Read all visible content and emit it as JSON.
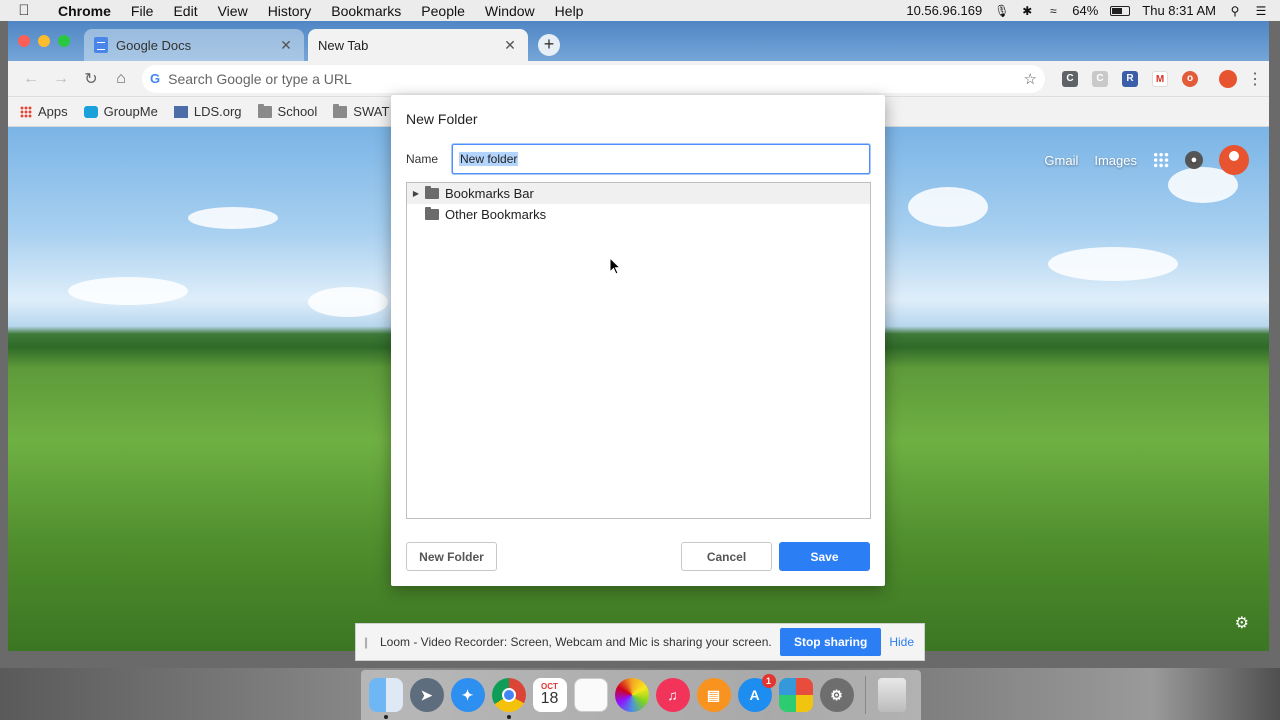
{
  "menubar": {
    "app_name": "Chrome",
    "menus": [
      "File",
      "Edit",
      "View",
      "History",
      "Bookmarks",
      "People",
      "Window",
      "Help"
    ],
    "ip": "10.56.96.169",
    "battery": "64%",
    "battery_level": 0.64,
    "clock": "Thu 8:31 AM"
  },
  "tabs": [
    {
      "title": "Google Docs",
      "active": false
    },
    {
      "title": "New Tab",
      "active": true
    }
  ],
  "omnibox": {
    "placeholder": "Search Google or type a URL"
  },
  "bookmarks_bar": [
    {
      "label": "Apps",
      "icon": "apps-grid-icon"
    },
    {
      "label": "GroupMe",
      "icon": "groupme-icon"
    },
    {
      "label": "LDS.org",
      "icon": "lds-icon"
    },
    {
      "label": "School",
      "icon": "folder-icon"
    },
    {
      "label": "SWAT",
      "icon": "folder-icon"
    }
  ],
  "page": {
    "gmail": "Gmail",
    "images": "Images"
  },
  "dialog": {
    "title": "New Folder",
    "name_label": "Name",
    "name_value": "New folder",
    "tree": [
      {
        "label": "Bookmarks Bar",
        "expandable": true,
        "highlighted": true
      },
      {
        "label": "Other Bookmarks",
        "expandable": false,
        "highlighted": false
      }
    ],
    "new_folder_button": "New Folder",
    "cancel_button": "Cancel",
    "save_button": "Save"
  },
  "loom_bar": {
    "message": "Loom - Video Recorder: Screen, Webcam and Mic is sharing your screen.",
    "stop_button": "Stop sharing",
    "hide_link": "Hide"
  },
  "dock": {
    "calendar_month": "OCT",
    "calendar_day": "18",
    "app_store_badge": "1"
  },
  "colors": {
    "accent": "#2c7ef5",
    "profile": "#e8542f"
  }
}
